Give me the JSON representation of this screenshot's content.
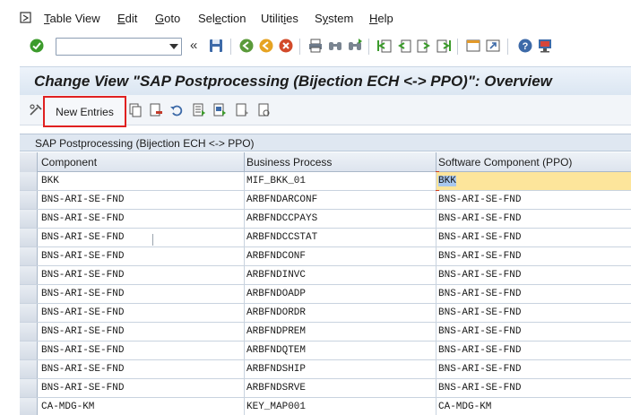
{
  "menu": {
    "items": [
      {
        "pre": "",
        "ul": "T",
        "post": "able View"
      },
      {
        "pre": "",
        "ul": "E",
        "post": "dit"
      },
      {
        "pre": "",
        "ul": "G",
        "post": "oto"
      },
      {
        "pre": "Sel",
        "ul": "e",
        "post": "ction"
      },
      {
        "pre": "Utilit",
        "ul": "i",
        "post": "es"
      },
      {
        "pre": "S",
        "ul": "y",
        "post": "stem"
      },
      {
        "pre": "",
        "ul": "H",
        "post": "elp"
      }
    ]
  },
  "toolbar": {
    "command_field_value": "",
    "collapse_glyph": "«"
  },
  "title": "Change View \"SAP Postprocessing (Bijection ECH <-> PPO)\": Overview",
  "app_toolbar": {
    "new_entries_label": "New Entries"
  },
  "table": {
    "caption": "SAP Postprocessing (Bijection ECH <-> PPO)",
    "columns": [
      "Component",
      "Business Process",
      "Software Component (PPO)"
    ],
    "rows": [
      [
        "BKK",
        "MIF_BKK_01",
        "BKK"
      ],
      [
        "BNS-ARI-SE-FND",
        "ARBFNDARCONF",
        "BNS-ARI-SE-FND"
      ],
      [
        "BNS-ARI-SE-FND",
        "ARBFNDCCPAYS",
        "BNS-ARI-SE-FND"
      ],
      [
        "BNS-ARI-SE-FND",
        "ARBFNDCCSTAT",
        "BNS-ARI-SE-FND"
      ],
      [
        "BNS-ARI-SE-FND",
        "ARBFNDCONF",
        "BNS-ARI-SE-FND"
      ],
      [
        "BNS-ARI-SE-FND",
        "ARBFNDINVC",
        "BNS-ARI-SE-FND"
      ],
      [
        "BNS-ARI-SE-FND",
        "ARBFNDOADP",
        "BNS-ARI-SE-FND"
      ],
      [
        "BNS-ARI-SE-FND",
        "ARBFNDORDR",
        "BNS-ARI-SE-FND"
      ],
      [
        "BNS-ARI-SE-FND",
        "ARBFNDPREM",
        "BNS-ARI-SE-FND"
      ],
      [
        "BNS-ARI-SE-FND",
        "ARBFNDQTEM",
        "BNS-ARI-SE-FND"
      ],
      [
        "BNS-ARI-SE-FND",
        "ARBFNDSHIP",
        "BNS-ARI-SE-FND"
      ],
      [
        "BNS-ARI-SE-FND",
        "ARBFNDSRVE",
        "BNS-ARI-SE-FND"
      ],
      [
        "CA-MDG-KM",
        "KEY_MAP001",
        "CA-MDG-KM"
      ]
    ]
  },
  "colors": {
    "highlight_border": "#e02020",
    "focus_cell": "#fde59b",
    "focus_text": "#a9c8ee"
  }
}
